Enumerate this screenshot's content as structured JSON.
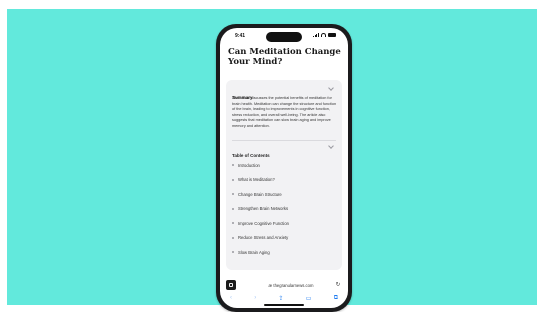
{
  "status_bar": {
    "time": "9:41"
  },
  "article": {
    "title": "Can Meditation Change Your Mind?",
    "summary": {
      "label": "Summary",
      "text": "The article discusses the potential benefits of meditation for brain health. Meditation can change the structure and function of the brain, leading to improvements in cognitive function, stress reduction, and overall well-being. The article also suggests that meditation can slow brain aging and improve memory and attention."
    },
    "toc": {
      "label": "Table of Contents",
      "items": [
        "Introduction",
        "What is Meditation?",
        "Change Brain Structure",
        "Strengthen Brain Networks",
        "Improve Cognitive Function",
        "Reduce Stress and Anxiety",
        "Slow Brain Aging"
      ]
    }
  },
  "browser": {
    "url": "æ thegranularnews.com",
    "toolbar_icons": [
      "back-icon",
      "forward-icon",
      "share-icon",
      "bookmarks-icon",
      "tabs-icon"
    ]
  },
  "colors": {
    "background": "#62e9dc",
    "accent": "#1f7cf0"
  }
}
